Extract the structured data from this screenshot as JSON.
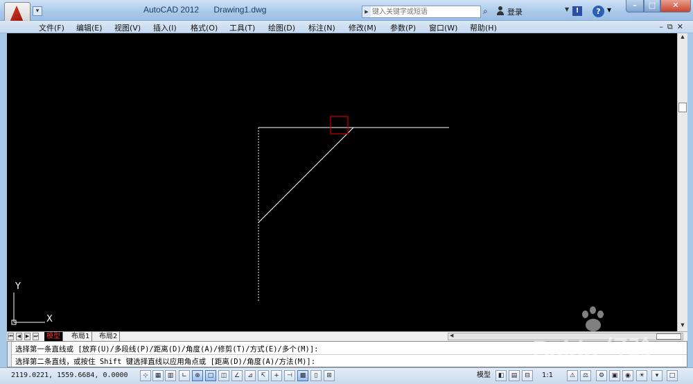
{
  "titlebar": {
    "app_name": "AutoCAD 2012",
    "document": "Drawing1.dwg",
    "search_placeholder": "键入关键字或短语",
    "login_label": "登录",
    "help_glyph": "?",
    "exchange_glyph": "!"
  },
  "menus": [
    {
      "label": "文件(F)"
    },
    {
      "label": "编辑(E)"
    },
    {
      "label": "视图(V)"
    },
    {
      "label": "插入(I)"
    },
    {
      "label": "格式(O)"
    },
    {
      "label": "工具(T)"
    },
    {
      "label": "绘图(D)"
    },
    {
      "label": "标注(N)"
    },
    {
      "label": "修改(M)"
    },
    {
      "label": "参数(P)"
    },
    {
      "label": "窗口(W)"
    },
    {
      "label": "帮助(H)"
    }
  ],
  "ucs": {
    "x_label": "X",
    "y_label": "Y"
  },
  "tabs": {
    "model": "模型",
    "layout1": "布局1",
    "layout2": "布局2"
  },
  "command_line": {
    "line1": "选择第一条直线或 [放弃(U)/多段线(P)/距离(D)/角度(A)/修剪(T)/方式(E)/多个(M)]:",
    "line2": "选择第二条直线，或按住 Shift 键选择直线以应用角点或 [距离(D)/角度(A)/方法(M)]:"
  },
  "statusbar": {
    "coordinates": "2119.0221, 1559.6684, 0.0000",
    "model_label": "模型",
    "annotation_scale": "1:1",
    "toggle_icons": [
      "snap-icon",
      "grid-icon",
      "ortho-icon",
      "polar-icon",
      "osnap-icon",
      "otrack-icon",
      "ducs-icon",
      "dyn-icon",
      "lineweight-icon",
      "transparency-icon",
      "quick-properties-icon",
      "selection-cycling-icon"
    ]
  },
  "colors": {
    "canvas_bg": "#000000",
    "geometry": "#ffffff",
    "pickbox": "#cc0000",
    "model_tab_text": "#ee3333"
  },
  "watermark": {
    "brand": "Baidu 经验",
    "url": "jingyan.baidu.com"
  }
}
